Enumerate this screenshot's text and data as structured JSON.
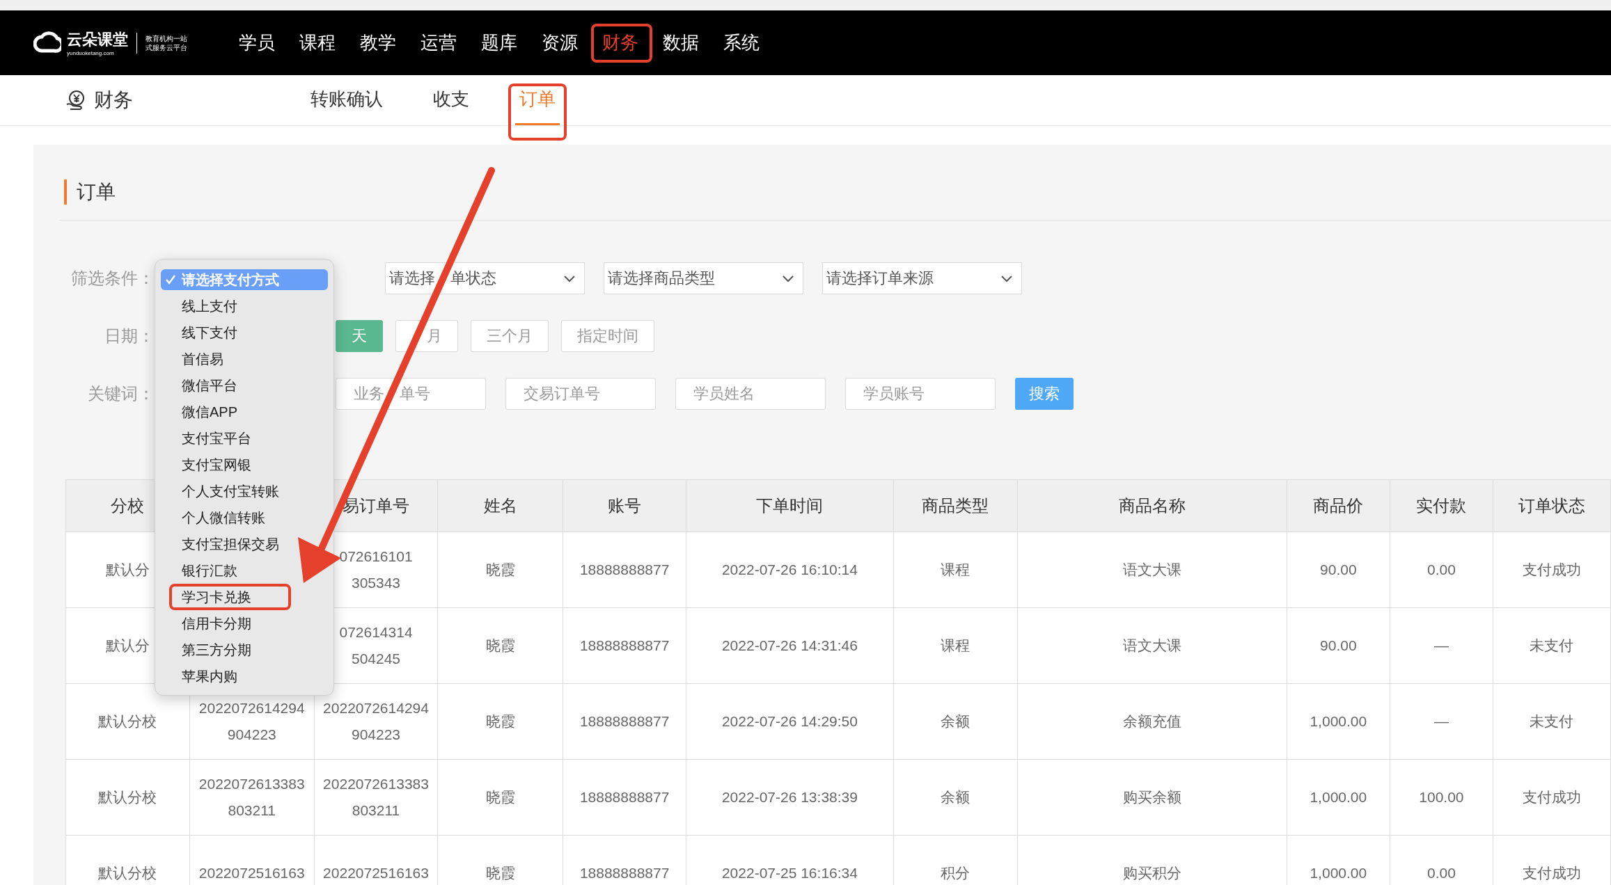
{
  "header": {
    "logo": {
      "name": "云朵课堂",
      "domain": "yunduoketang.com",
      "slogan_lines": [
        "教育机构一站",
        "式服务云平台"
      ]
    },
    "nav": [
      {
        "label": "学员",
        "selected": false,
        "boxed": false
      },
      {
        "label": "课程",
        "selected": false,
        "boxed": false
      },
      {
        "label": "教学",
        "selected": false,
        "boxed": false
      },
      {
        "label": "运营",
        "selected": false,
        "boxed": false
      },
      {
        "label": "题库",
        "selected": false,
        "boxed": false
      },
      {
        "label": "资源",
        "selected": false,
        "boxed": false
      },
      {
        "label": "财务",
        "selected": true,
        "boxed": true
      },
      {
        "label": "数据",
        "selected": false,
        "boxed": false
      },
      {
        "label": "系统",
        "selected": false,
        "boxed": false
      }
    ]
  },
  "subnav": {
    "title": "财务",
    "tabs": [
      {
        "label": "转账确认",
        "selected": false,
        "boxed": false
      },
      {
        "label": "收支",
        "selected": false,
        "boxed": false
      },
      {
        "label": "订单",
        "selected": true,
        "boxed": true
      }
    ]
  },
  "section_title": "订单",
  "filter_row": {
    "label": "筛选条件：",
    "selects": [
      {
        "text": "请选择　单状态"
      },
      {
        "text": "请选择商品类型"
      },
      {
        "text": "请选择订单来源"
      }
    ]
  },
  "date_row": {
    "label": "日期：",
    "buttons": [
      {
        "label": "天",
        "selected": true
      },
      {
        "label": "　月",
        "selected": false
      },
      {
        "label": "三个月",
        "selected": false
      },
      {
        "label": "指定时间",
        "selected": false
      }
    ]
  },
  "keyword_row": {
    "label": "关键词：",
    "fields": [
      {
        "placeholder": "业务　单号"
      },
      {
        "placeholder": "交易订单号"
      },
      {
        "placeholder": "学员姓名"
      },
      {
        "placeholder": "学员账号"
      }
    ],
    "search_button": "搜索"
  },
  "payment_dropdown": {
    "options": [
      {
        "label": "请选择支付方式",
        "selected": true,
        "boxed": false
      },
      {
        "label": "线上支付",
        "selected": false,
        "boxed": false
      },
      {
        "label": "线下支付",
        "selected": false,
        "boxed": false
      },
      {
        "label": "首信易",
        "selected": false,
        "boxed": false
      },
      {
        "label": "微信平台",
        "selected": false,
        "boxed": false
      },
      {
        "label": "微信APP",
        "selected": false,
        "boxed": false
      },
      {
        "label": "支付宝平台",
        "selected": false,
        "boxed": false
      },
      {
        "label": "支付宝网银",
        "selected": false,
        "boxed": false
      },
      {
        "label": "个人支付宝转账",
        "selected": false,
        "boxed": false
      },
      {
        "label": "个人微信转账",
        "selected": false,
        "boxed": false
      },
      {
        "label": "支付宝担保交易",
        "selected": false,
        "boxed": false
      },
      {
        "label": "银行汇款",
        "selected": false,
        "boxed": false
      },
      {
        "label": "学习卡兑换",
        "selected": false,
        "boxed": true
      },
      {
        "label": "信用卡分期",
        "selected": false,
        "boxed": false
      },
      {
        "label": "第三方分期",
        "selected": false,
        "boxed": false
      },
      {
        "label": "苹果内购",
        "selected": false,
        "boxed": false
      }
    ]
  },
  "table": {
    "columns": [
      "分校",
      null,
      "易订单号",
      "姓名",
      "账号",
      "下单时间",
      "商品类型",
      "商品名称",
      "商品价",
      "实付款",
      "订单状态"
    ],
    "rows": [
      [
        "默认分",
        null,
        "072616101\n305343",
        "晓霞",
        "18888888877",
        "2022-07-26 16:10:14",
        "课程",
        "语文大课",
        "90.00",
        "0.00",
        "支付成功"
      ],
      [
        "默认分",
        null,
        "072614314\n504245",
        "晓霞",
        "18888888877",
        "2022-07-26 14:31:46",
        "课程",
        "语文大课",
        "90.00",
        "—",
        "未支付"
      ],
      [
        "默认分校",
        "2022072614294904223",
        "2022072614294904223",
        "晓霞",
        "18888888877",
        "2022-07-26 14:29:50",
        "余额",
        "余额充值",
        "1,000.00",
        "—",
        "未支付"
      ],
      [
        "默认分校",
        "2022072613383803211",
        "2022072613383803211",
        "晓霞",
        "18888888877",
        "2022-07-26 13:38:39",
        "余额",
        "购买余额",
        "1,000.00",
        "100.00",
        "支付成功"
      ],
      [
        "默认分校",
        "2022072516163",
        "2022072516163",
        "晓霞",
        "18888888877",
        "2022-07-25 16:16:34",
        "积分",
        "购买积分",
        "1,000.00",
        "0.00",
        "支付成功"
      ]
    ]
  },
  "arrow": true
}
